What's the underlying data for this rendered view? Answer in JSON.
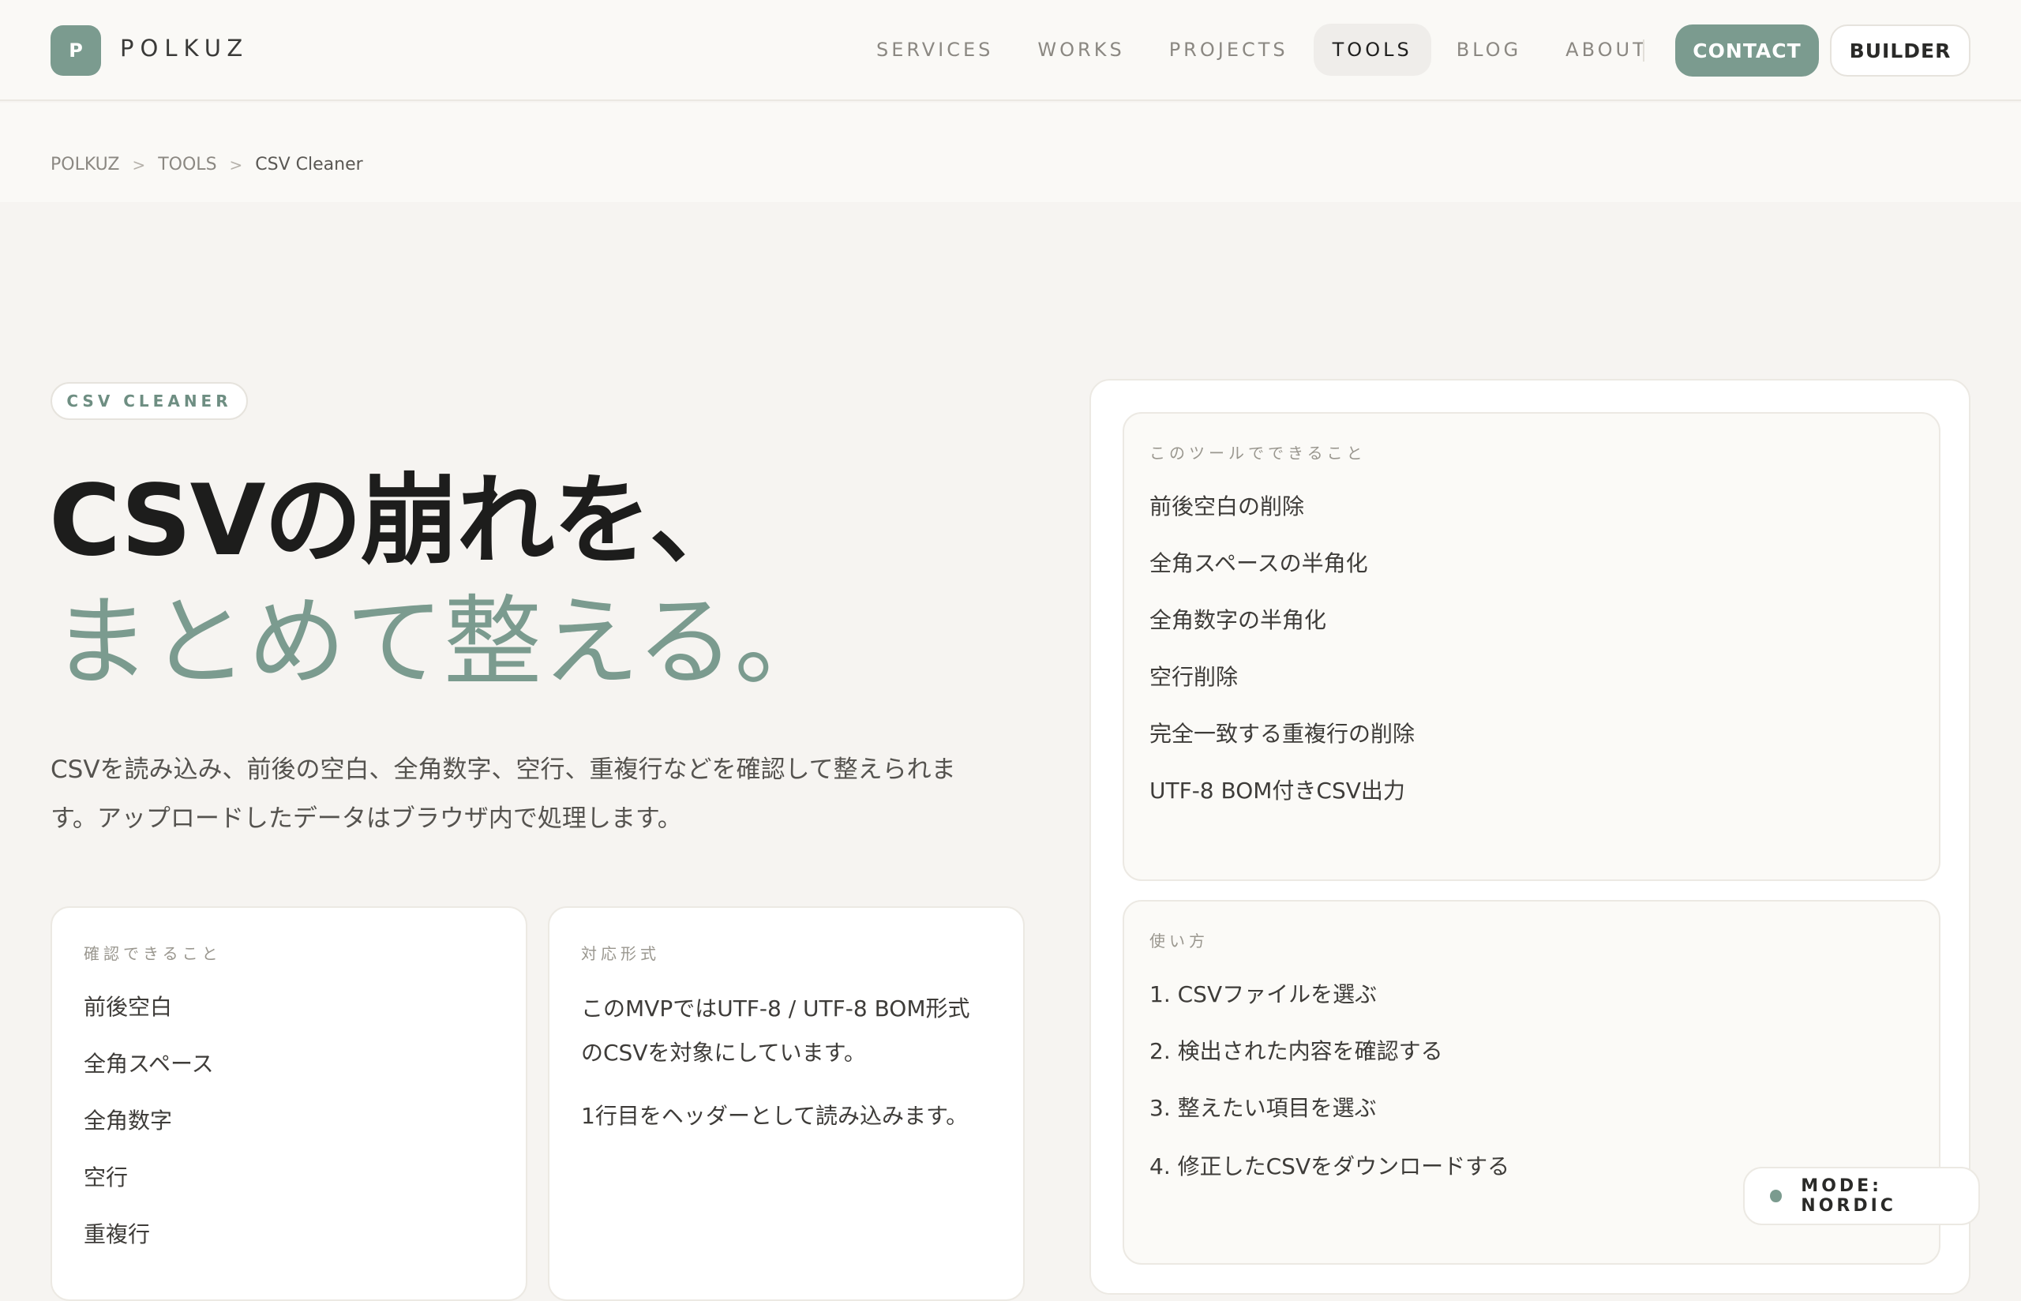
{
  "brand": {
    "logo_letter": "P",
    "name": "POLKUZ"
  },
  "nav": {
    "items": [
      {
        "label": "SERVICES",
        "active": false
      },
      {
        "label": "WORKS",
        "active": false
      },
      {
        "label": "PROJECTS",
        "active": false
      },
      {
        "label": "TOOLS",
        "active": true
      },
      {
        "label": "BLOG",
        "active": false
      },
      {
        "label": "ABOUT",
        "active": false
      }
    ],
    "contact_label": "CONTACT",
    "builder_label": "BUILDER"
  },
  "breadcrumb": [
    "POLKUZ",
    "TOOLS",
    "CSV Cleaner"
  ],
  "breadcrumb_separator": ">",
  "hero": {
    "tag": "CSV CLEANER",
    "title_line1": "CSVの崩れを、",
    "title_line2": "まとめて整える。",
    "description": "CSVを読み込み、前後の空白、全角数字、空行、重複行などを確認して整えられます。アップロードしたデータはブラウザ内で処理します。"
  },
  "checks_card": {
    "label": "確認できること",
    "items": [
      "前後空白",
      "全角スペース",
      "全角数字",
      "空行",
      "重複行"
    ]
  },
  "formats_card": {
    "label": "対応形式",
    "paragraph1": "このMVPではUTF-8 / UTF-8 BOM形式のCSVを対象にしています。",
    "paragraph2": "1行目をヘッダーとして読み込みます。"
  },
  "features_card": {
    "label": "このツールでできること",
    "items": [
      "前後空白の削除",
      "全角スペースの半角化",
      "全角数字の半角化",
      "空行削除",
      "完全一致する重複行の削除",
      "UTF-8 BOM付きCSV出力"
    ]
  },
  "usage_card": {
    "label": "使い方",
    "steps": [
      "1. CSVファイルを選ぶ",
      "2. 検出された内容を確認する",
      "3. 整えたい項目を選ぶ",
      "4. 修正したCSVをダウンロードする"
    ]
  },
  "mode": {
    "label": "MODE: NORDIC"
  },
  "colors": {
    "accent": "#7b9b8f",
    "background": "#f6f4f1",
    "text": "#3a3a38"
  }
}
